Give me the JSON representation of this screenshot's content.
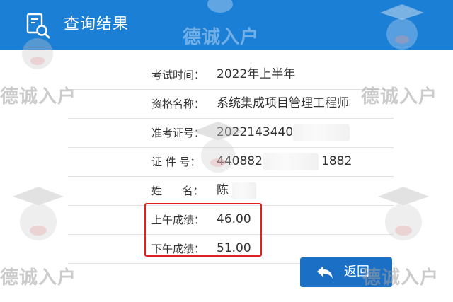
{
  "header": {
    "title": "查询结果",
    "icon": "document-search-icon",
    "background": "#1b7fd6"
  },
  "results": [
    {
      "label": "考试时间：",
      "value": "2022年上半年"
    },
    {
      "label": "资格名称：",
      "value": "系统集成项目管理工程师"
    },
    {
      "label": "准考证号：",
      "value": "2022143440"
    },
    {
      "label": "证 件 号：",
      "value": "440882",
      "value_suffix": "1882"
    },
    {
      "label": "姓      名：",
      "value": "陈"
    },
    {
      "label": "上午成绩：",
      "value": "46.00"
    },
    {
      "label": "下午成绩：",
      "value": "51.00"
    }
  ],
  "highlight_color": "#e02020",
  "back_button": {
    "label": "返回",
    "icon": "back-arrow-icon",
    "color": "#1b6fc4"
  },
  "watermark": {
    "text": "德诚入户",
    "mascot": "graduate-dog-mascot-icon"
  }
}
